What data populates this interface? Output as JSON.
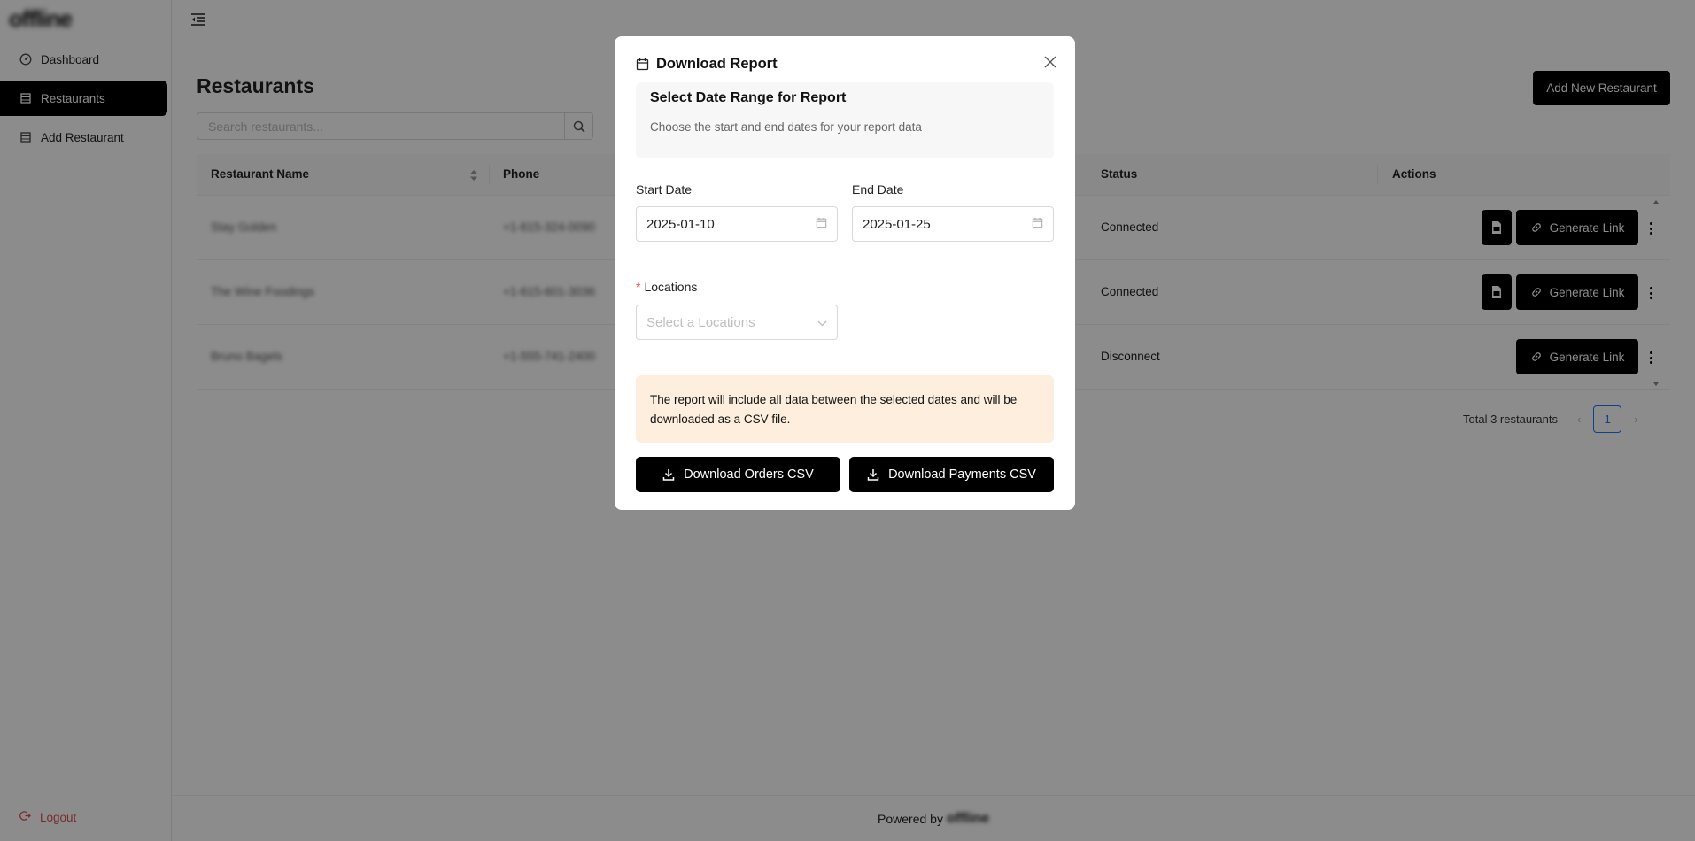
{
  "sidebar": {
    "logo": "offline",
    "items": [
      {
        "label": "Dashboard",
        "icon": "dashboard-icon"
      },
      {
        "label": "Restaurants",
        "icon": "restaurant-icon"
      },
      {
        "label": "Add Restaurant",
        "icon": "restaurant-add-icon"
      }
    ],
    "logout_label": "Logout"
  },
  "main": {
    "title": "Restaurants",
    "search_placeholder": "Search restaurants...",
    "add_button": "Add New Restaurant",
    "table": {
      "columns": [
        "Restaurant Name",
        "Phone",
        "Status",
        "Actions"
      ],
      "rows": [
        {
          "name": "Stay Golden",
          "phone": "+1-615-324-0090",
          "status": "Connected",
          "has_report_button": true,
          "action": "Generate Link"
        },
        {
          "name": "The Wine Foodings",
          "phone": "+1-615-601-3036",
          "status": "Connected",
          "has_report_button": true,
          "action": "Generate Link"
        },
        {
          "name": "Bruno Bagels",
          "phone": "+1-555-741-2400",
          "status": "Disconnect",
          "has_report_button": false,
          "action": "Generate Link"
        }
      ]
    },
    "pagination": {
      "total_text": "Total 3 restaurants",
      "current_page": "1",
      "prev": "‹",
      "next": "›"
    }
  },
  "footer": {
    "powered_by": "Powered by",
    "brand": "offline"
  },
  "modal": {
    "title": "Download Report",
    "info_heading": "Select Date Range for Report",
    "info_subtext": "Choose the start and end dates for your report data",
    "start_date_label": "Start Date",
    "start_date_value": "2025-01-10",
    "end_date_label": "End Date",
    "end_date_value": "2025-01-25",
    "locations_required_mark": "*",
    "locations_label": "Locations",
    "locations_placeholder": "Select a Locations",
    "note": "The report will include all data between the selected dates and will be downloaded as a CSV file.",
    "download_orders": "Download Orders CSV",
    "download_payments": "Download Payments CSV"
  },
  "colors": {
    "accent": "#000000",
    "overlay": "rgba(0,0,0,0.45)",
    "note_background": "#fdeedd",
    "logout": "#d9534f",
    "pagination_active": "#1677ff"
  }
}
